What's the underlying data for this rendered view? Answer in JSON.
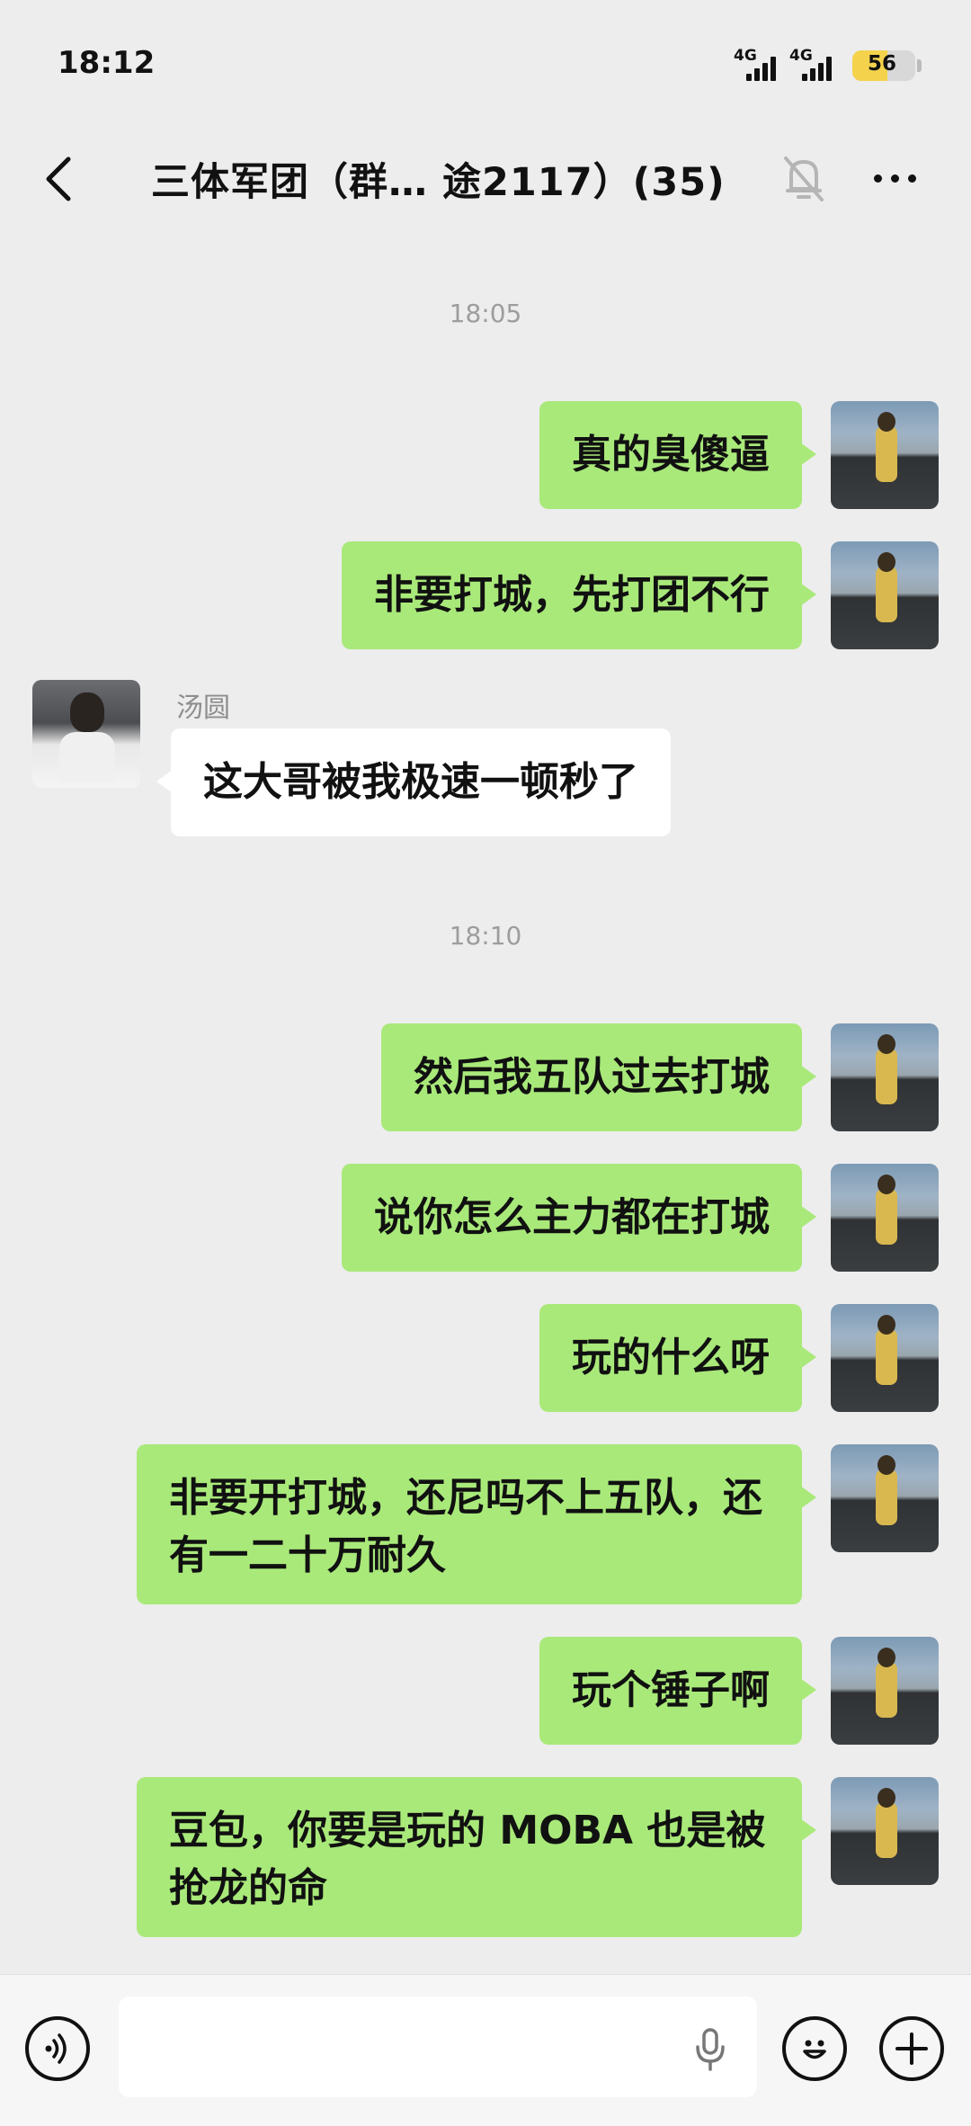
{
  "status_bar": {
    "time": "18:12",
    "signal_1": "4G",
    "signal_2": "4G",
    "battery": "56"
  },
  "header": {
    "title": "三体军团（群… 途2117）(35)"
  },
  "messages": [
    {
      "type": "timestamp",
      "text": "18:05"
    },
    {
      "type": "sent",
      "text": "真的臭傻逼"
    },
    {
      "type": "sent",
      "text": "非要打城，先打团不行"
    },
    {
      "type": "received",
      "sender": "汤圆",
      "text": "这大哥被我极速一顿秒了"
    },
    {
      "type": "timestamp",
      "text": "18:10"
    },
    {
      "type": "sent",
      "text": "然后我五队过去打城"
    },
    {
      "type": "sent",
      "text": "说你怎么主力都在打城"
    },
    {
      "type": "sent",
      "text": "玩的什么呀"
    },
    {
      "type": "sent",
      "text": "非要开打城，还尼吗不上五队，还有一二十万耐久"
    },
    {
      "type": "sent",
      "text": "玩个锤子啊"
    },
    {
      "type": "sent",
      "text": "豆包，你要是玩的 MOBA 也是被抢龙的命"
    }
  ],
  "input_bar": {
    "voice_icon": "voice-mode-icon",
    "mic_icon": "microphone-icon",
    "emoji_icon": "emoji-icon",
    "plus_icon": "plus-icon"
  }
}
